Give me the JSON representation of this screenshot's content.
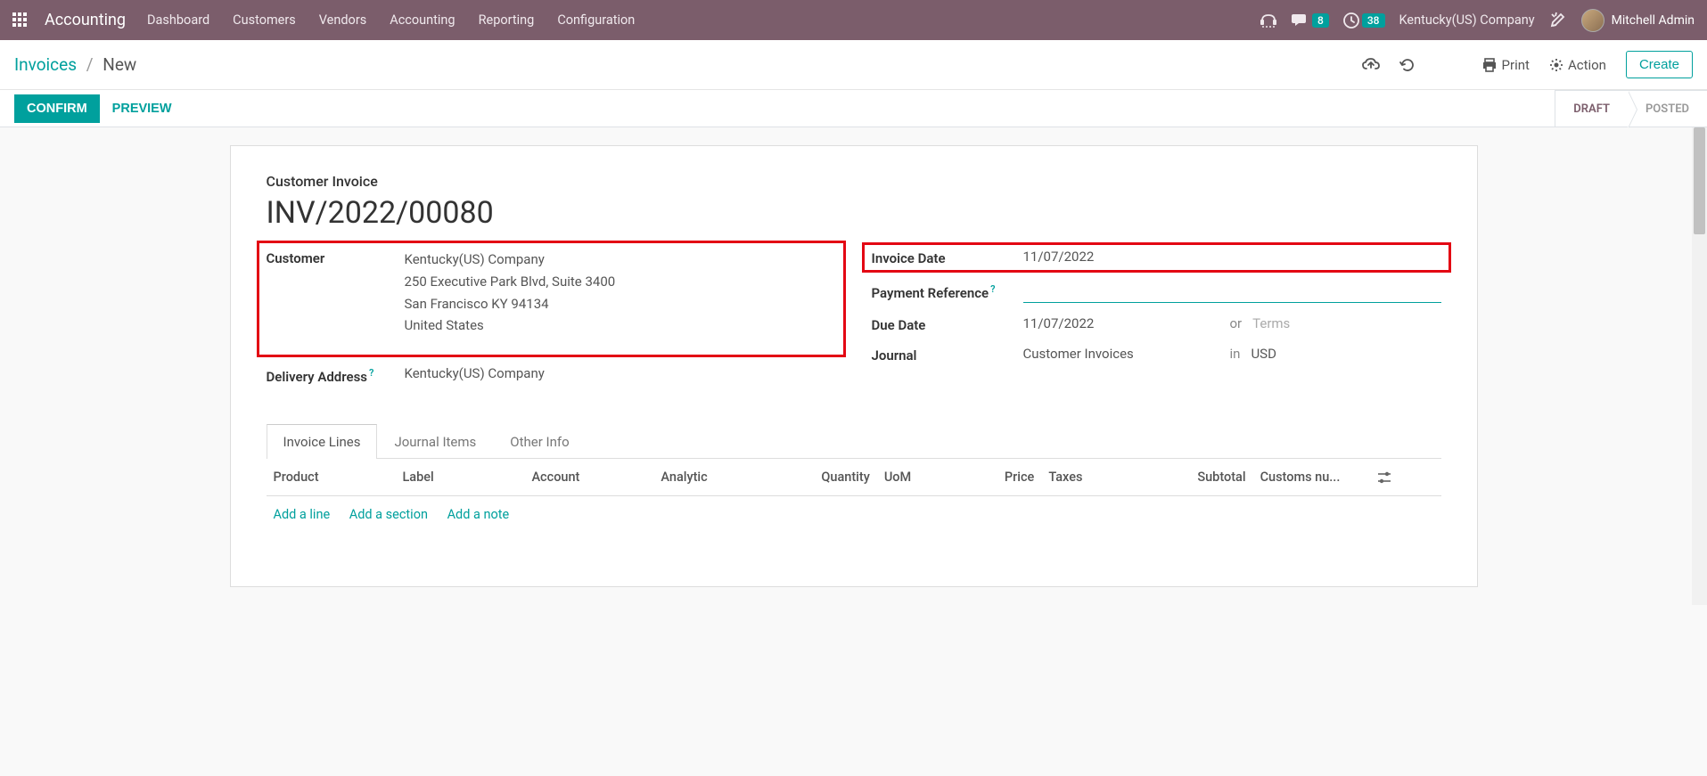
{
  "topnav": {
    "app_name": "Accounting",
    "menu": [
      "Dashboard",
      "Customers",
      "Vendors",
      "Accounting",
      "Reporting",
      "Configuration"
    ],
    "messages_count": "8",
    "activities_count": "38",
    "company": "Kentucky(US) Company",
    "user": "Mitchell Admin"
  },
  "breadcrumb": {
    "root": "Invoices",
    "current": "New",
    "print": "Print",
    "action": "Action",
    "create": "Create"
  },
  "statusbar": {
    "confirm": "CONFIRM",
    "preview": "PREVIEW",
    "draft": "DRAFT",
    "posted": "POSTED"
  },
  "form": {
    "doc_type": "Customer Invoice",
    "doc_title": "INV/2022/00080",
    "labels": {
      "customer": "Customer",
      "delivery": "Delivery Address",
      "invoice_date": "Invoice Date",
      "payment_ref": "Payment Reference",
      "due_date": "Due Date",
      "journal": "Journal",
      "or": "or",
      "in": "in",
      "terms_placeholder": "Terms"
    },
    "customer": {
      "name": "Kentucky(US) Company",
      "street": "250 Executive Park Blvd, Suite 3400",
      "city": "San Francisco KY 94134",
      "country": "United States"
    },
    "delivery_address": "Kentucky(US) Company",
    "invoice_date": "11/07/2022",
    "payment_reference": "",
    "due_date": "11/07/2022",
    "journal": "Customer Invoices",
    "currency": "USD"
  },
  "tabs": [
    "Invoice Lines",
    "Journal Items",
    "Other Info"
  ],
  "table": {
    "headers": [
      "Product",
      "Label",
      "Account",
      "Analytic",
      "Quantity",
      "UoM",
      "Price",
      "Taxes",
      "Subtotal",
      "Customs nu..."
    ],
    "add_line": "Add a line",
    "add_section": "Add a section",
    "add_note": "Add a note"
  }
}
